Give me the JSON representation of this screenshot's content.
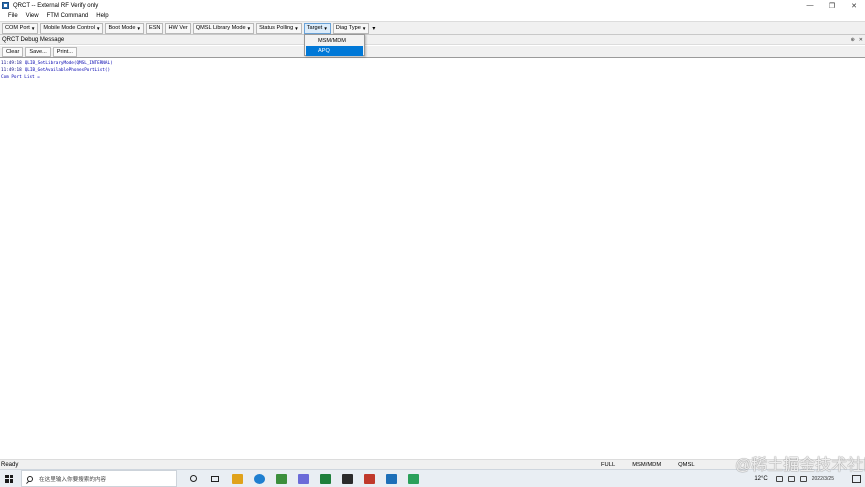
{
  "window": {
    "title": "QRCT -- External RF Verify only",
    "minimize": "—",
    "maximize": "❐",
    "close": "✕"
  },
  "menu": [
    "File",
    "View",
    "FTM Command",
    "Help"
  ],
  "toolbar": {
    "buttons": [
      {
        "label": "COM Port",
        "dropdown": true
      },
      {
        "label": "Mobile Mode Control",
        "dropdown": true
      },
      {
        "label": "Boot Mode",
        "dropdown": true
      },
      {
        "label": "ESN",
        "dropdown": false
      },
      {
        "label": "HW Ver",
        "dropdown": false
      },
      {
        "label": "QMSL Library Mode",
        "dropdown": true
      },
      {
        "label": "Status Polling",
        "dropdown": true
      },
      {
        "label": "Target",
        "dropdown": true
      },
      {
        "label": "Diag Type",
        "dropdown": true
      }
    ],
    "overflow": "▾"
  },
  "target_dropdown": {
    "options": [
      "MSM/MDM",
      "APQ"
    ],
    "selected": "APQ"
  },
  "debug_panel": {
    "title": "QRCT Debug Message",
    "pin": "⊕",
    "close": "✕",
    "buttons": [
      "Clear",
      "Save...",
      "Print..."
    ],
    "log": [
      {
        "time": "11:49:18",
        "msg": "QLIB_SetLibraryMode(QMSL_INTERNAL)"
      },
      {
        "time": "11:49:18",
        "msg": "QLIB_GetAvailablePhonesPortList()"
      },
      {
        "time": "",
        "msg": "Com Port List ="
      }
    ]
  },
  "status": {
    "left": "Ready",
    "segments": [
      "FULL",
      "MSM/MDM",
      "QMSL"
    ]
  },
  "watermark": "@稀土掘金技术社区",
  "taskbar": {
    "search_placeholder": "在这里输入你要搜索的内容",
    "weather": "12°C",
    "date": "2022/3/25",
    "app_colors": [
      "#e0a21b",
      "#1f7fd0",
      "#3c8f3c",
      "#6b6bd8",
      "#1e7f3b",
      "#2b2b2b",
      "#c0392b",
      "#1d6fb8",
      "#2aa05a"
    ]
  }
}
